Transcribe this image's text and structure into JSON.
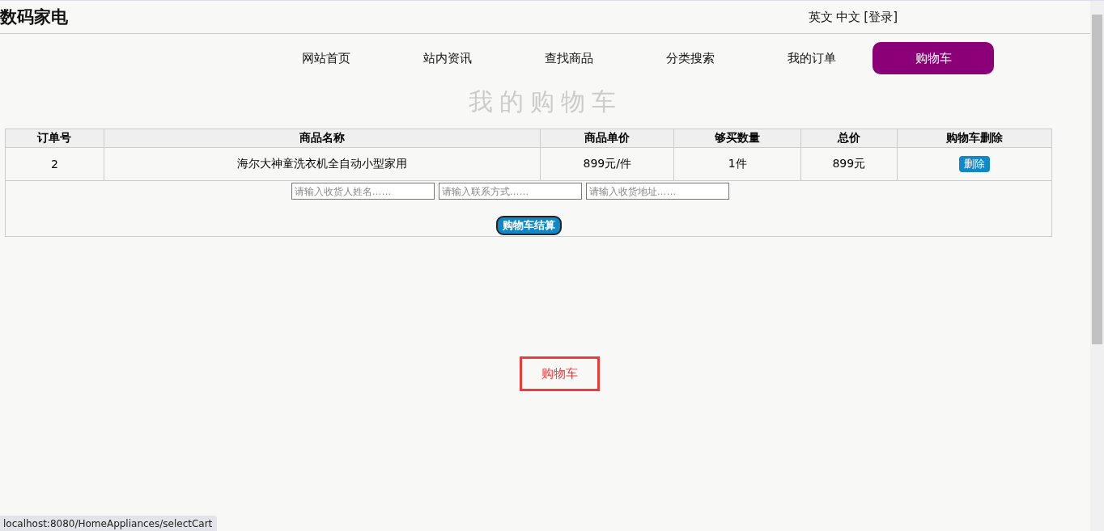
{
  "header": {
    "brand": "数码家电",
    "links": [
      {
        "label": "英文"
      },
      {
        "label": "中文"
      },
      {
        "label": "[登录]"
      }
    ]
  },
  "nav": [
    {
      "label": "网站首页",
      "selected": false
    },
    {
      "label": "站内资讯",
      "selected": false
    },
    {
      "label": "查找商品",
      "selected": false
    },
    {
      "label": "分类搜索",
      "selected": false
    },
    {
      "label": "我的订单",
      "selected": false
    },
    {
      "label": "购物车",
      "selected": true
    }
  ],
  "title": "我的购物车",
  "table": {
    "columns": [
      "订单号",
      "商品名称",
      "商品单价",
      "够买数量",
      "总价",
      "购物车删除"
    ],
    "rows": [
      {
        "cells": [
          "2",
          "海尔大神童洗衣机全自动小型家用",
          "899元/件",
          "1件",
          "899元"
        ],
        "action": "删除"
      }
    ]
  },
  "form": {
    "fields": [
      {
        "placeholder": "请输入收货人姓名……"
      },
      {
        "placeholder": "请输入联系方式……"
      },
      {
        "placeholder": "请输入收货地址……"
      }
    ],
    "submit": "购物车结算"
  },
  "footer_box": "购物车",
  "status_bar": "localhost:8080/HomeAppliances/selectCart"
}
